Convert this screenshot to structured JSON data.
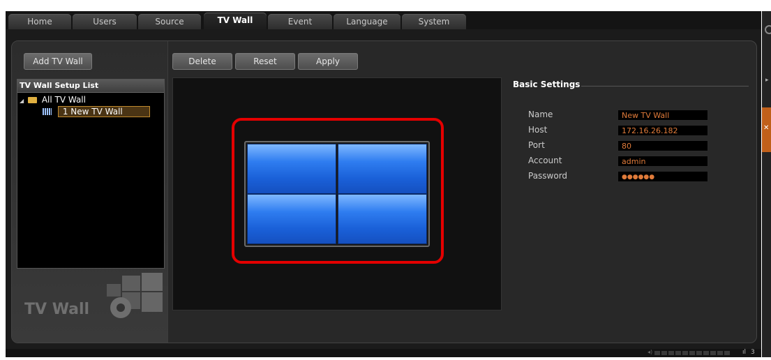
{
  "tabs": [
    "Home",
    "Users",
    "Source",
    "TV Wall",
    "Event",
    "Language",
    "System"
  ],
  "active_tab": "TV Wall",
  "toolbar": {
    "add": "Add TV Wall",
    "delete": "Delete",
    "reset": "Reset",
    "apply": "Apply"
  },
  "tree": {
    "header": "TV Wall Setup List",
    "root": "All TV Wall",
    "item": "1 New TV Wall"
  },
  "logo_text": "TV Wall",
  "settings": {
    "title": "Basic Settings",
    "fields": [
      {
        "label": "Name",
        "value": "New TV Wall"
      },
      {
        "label": "Host",
        "value": "172.16.26.182"
      },
      {
        "label": "Port",
        "value": "80"
      },
      {
        "label": "Account",
        "value": "admin"
      },
      {
        "label": "Password",
        "value": "●●●●●●"
      }
    ]
  },
  "wall": {
    "rows": 2,
    "cols": 2
  },
  "status": {
    "count": "3"
  },
  "colors": {
    "accent": "#e07b3a",
    "highlight": "#e40000",
    "screen": "#1a60d8"
  }
}
